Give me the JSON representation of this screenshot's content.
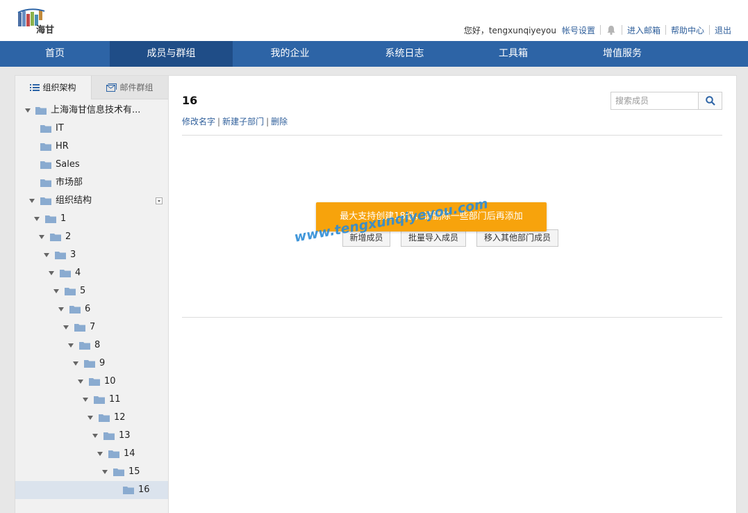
{
  "header": {
    "logo_text": "海甘",
    "greeting": "您好，tengxunqiyeyou",
    "links": {
      "account_settings": "帐号设置",
      "enter_mailbox": "进入邮箱",
      "help_center": "帮助中心",
      "logout": "退出"
    }
  },
  "nav": {
    "items": [
      {
        "label": "首页"
      },
      {
        "label": "成员与群组"
      },
      {
        "label": "我的企业"
      },
      {
        "label": "系统日志"
      },
      {
        "label": "工具箱"
      },
      {
        "label": "增值服务"
      }
    ],
    "active_index": 1
  },
  "sidebar": {
    "tabs": [
      {
        "label": "组织架构"
      },
      {
        "label": "邮件群组"
      }
    ],
    "tree": [
      {
        "label": "上海海甘信息技术有..."
      },
      {
        "label": "IT"
      },
      {
        "label": "HR"
      },
      {
        "label": "Sales"
      },
      {
        "label": "市场部"
      },
      {
        "label": "组织结构"
      },
      {
        "label": "1"
      },
      {
        "label": "2"
      },
      {
        "label": "3"
      },
      {
        "label": "4"
      },
      {
        "label": "5"
      },
      {
        "label": "6"
      },
      {
        "label": "7"
      },
      {
        "label": "8"
      },
      {
        "label": "9"
      },
      {
        "label": "10"
      },
      {
        "label": "11"
      },
      {
        "label": "12"
      },
      {
        "label": "13"
      },
      {
        "label": "14"
      },
      {
        "label": "15"
      },
      {
        "label": "16"
      }
    ],
    "selected": "16"
  },
  "main": {
    "dept_title": "16",
    "actions": {
      "rename": "修改名字",
      "new_sub_dept": "新建子部门",
      "delete": "删除",
      "separator": "|"
    },
    "search": {
      "placeholder": "搜索成员"
    },
    "buttons": {
      "add_member": "新增成员",
      "batch_import": "批量导入成员",
      "move_from_other": "移入其他部门成员"
    },
    "toast": "最大支持创建18级，请删除一些部门后再添加",
    "watermark": "www.tengxunqiyeyou.com"
  },
  "colors": {
    "nav_bg": "#2d64a6",
    "nav_active": "#1f4d87",
    "link": "#2f5f9b",
    "toast_bg": "#f7a30c",
    "selected_row": "#dbe3ed",
    "folder": "#8aabd0"
  }
}
